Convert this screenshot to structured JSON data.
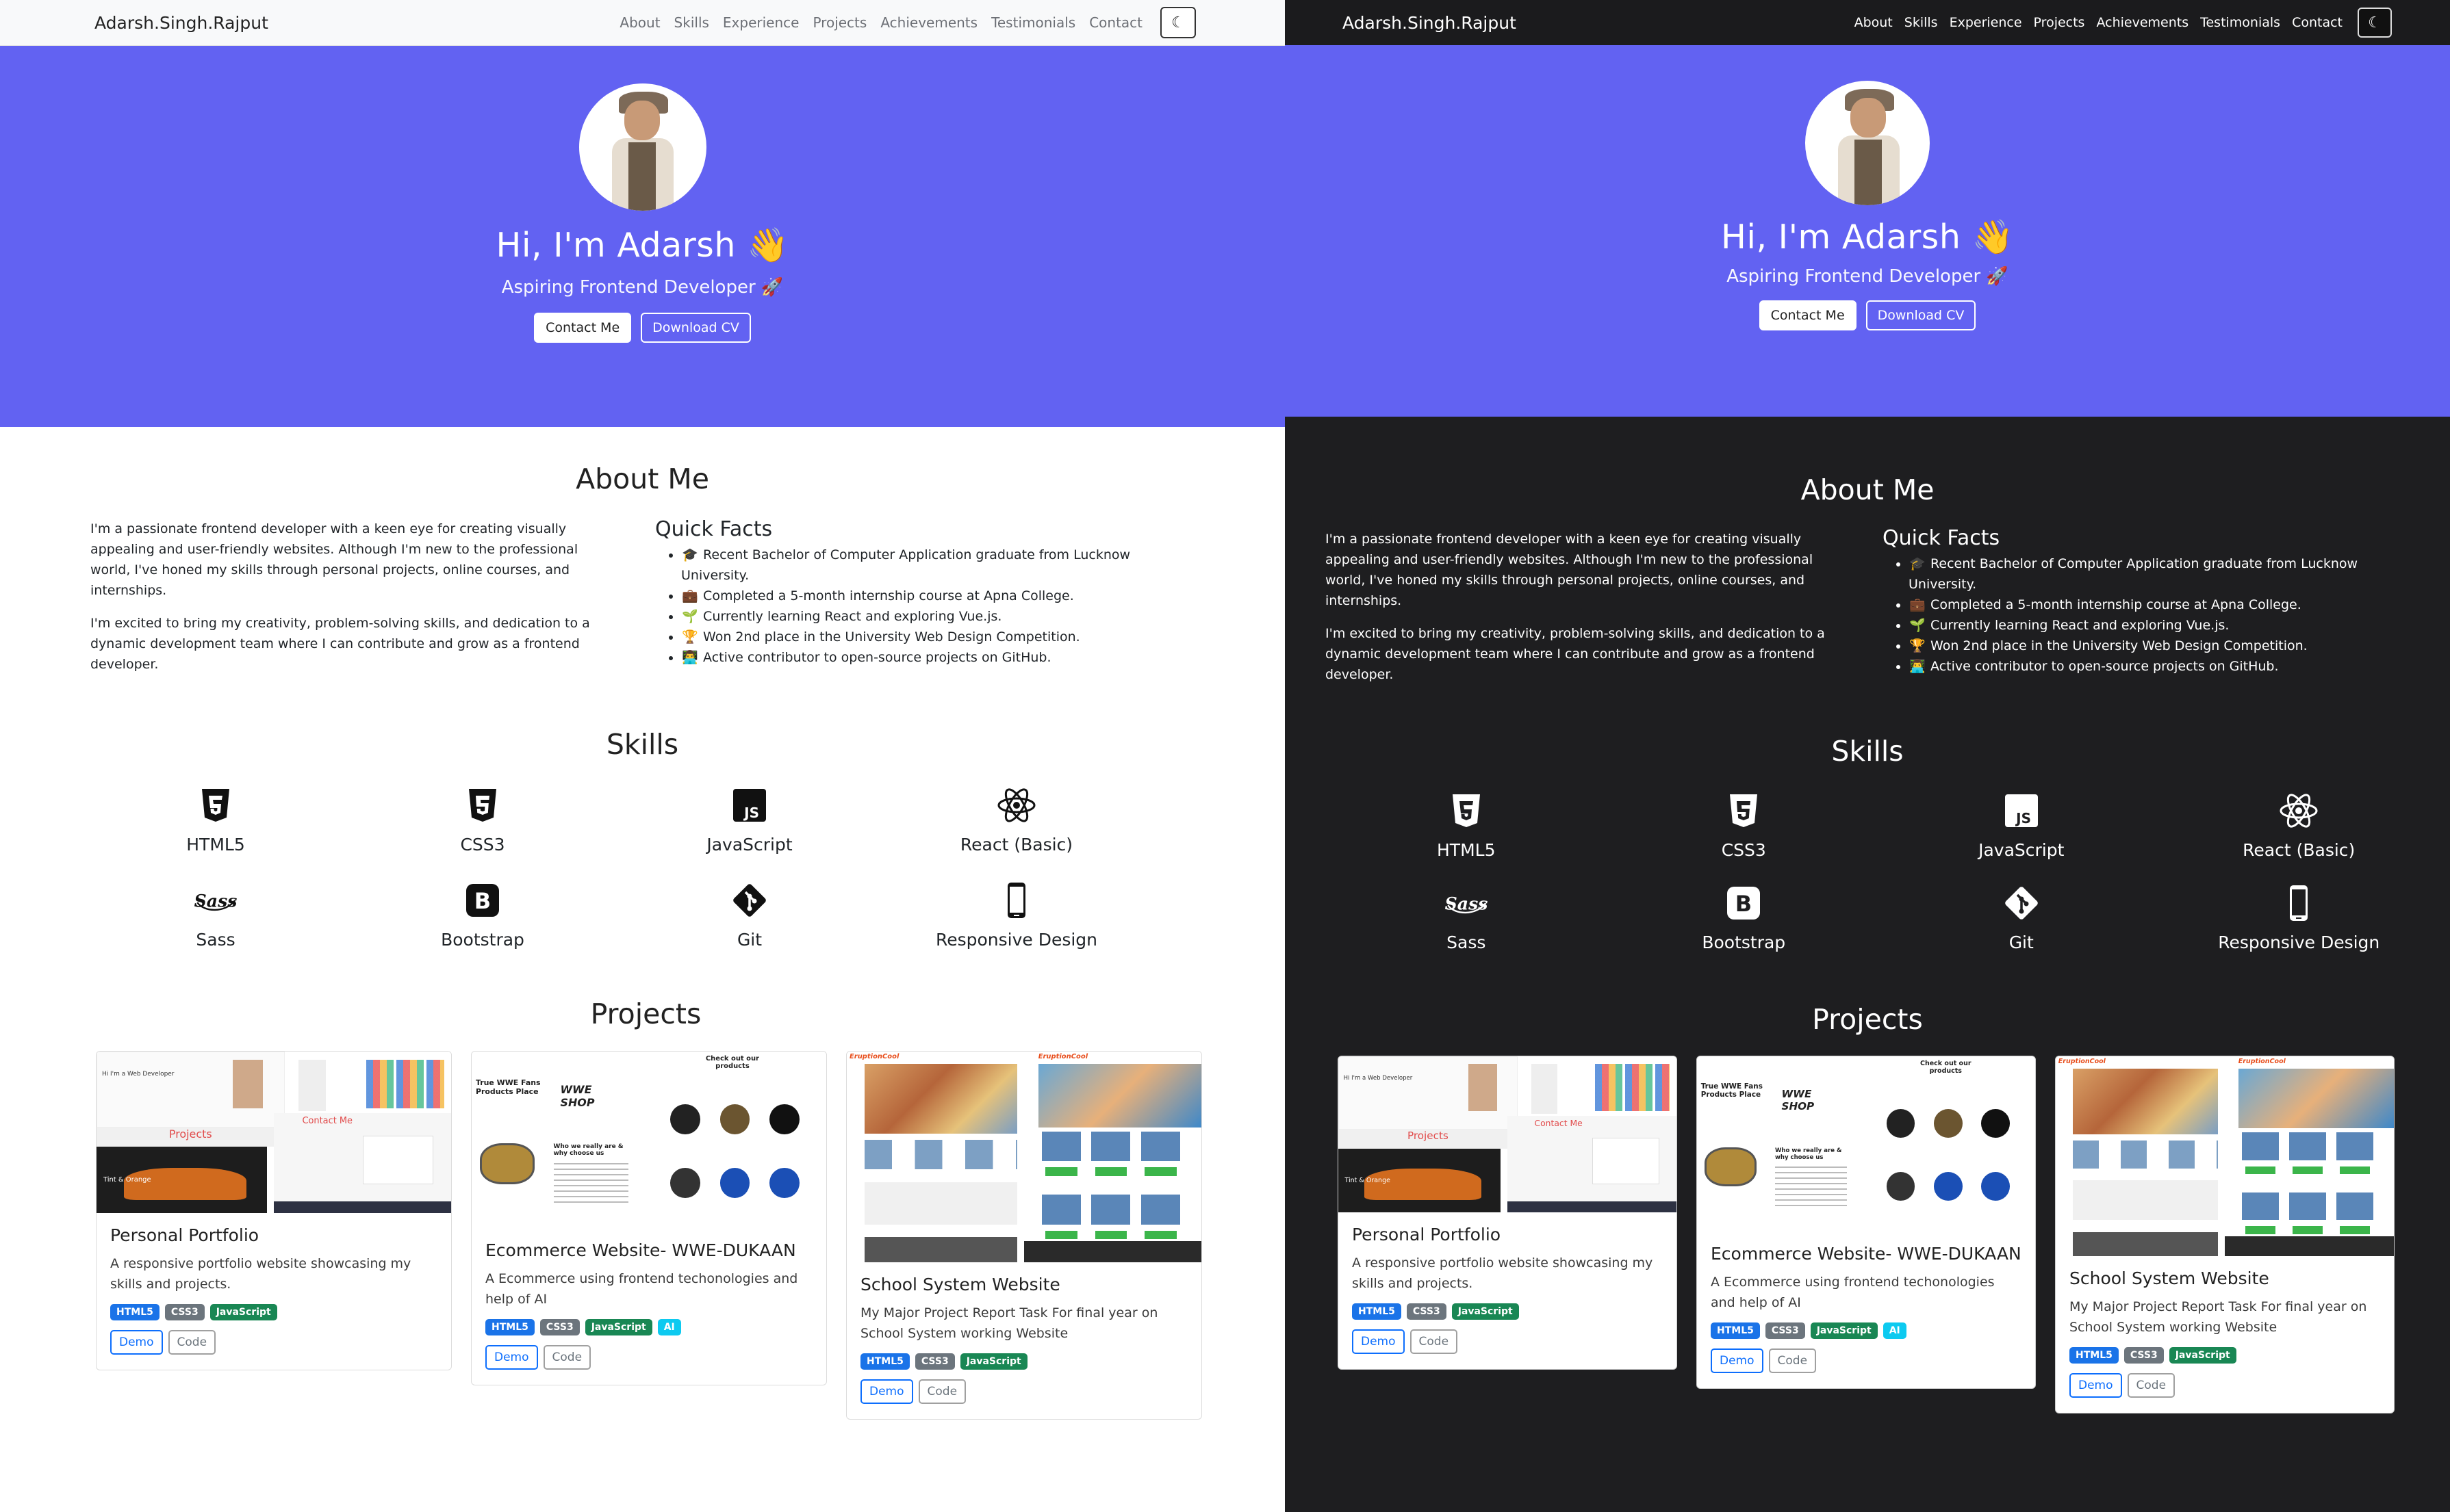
{
  "brand": "Adarsh.Singh.Rajput",
  "nav": [
    "About",
    "Skills",
    "Experience",
    "Projects",
    "Achievements",
    "Testimonials",
    "Contact"
  ],
  "theme_toggle_icon": "moon-icon",
  "hero": {
    "greeting": "Hi, I'm Adarsh 👋",
    "subtitle": "Aspiring Frontend Developer 🚀",
    "contact_button": "Contact Me",
    "cv_button": "Download CV",
    "bg_color": "#6262f2"
  },
  "about": {
    "title": "About Me",
    "paragraphs": [
      "I'm a passionate frontend developer with a keen eye for creating visually appealing and user-friendly websites. Although I'm new to the professional world, I've honed my skills through personal projects, online courses, and internships.",
      "I'm excited to bring my creativity, problem-solving skills, and dedication to a dynamic development team where I can contribute and grow as a frontend developer."
    ],
    "facts_title": "Quick Facts",
    "facts": [
      {
        "icon": "🎓",
        "text": "Recent Bachelor of Computer Application graduate from Lucknow University."
      },
      {
        "icon": "💼",
        "text": "Completed a 5-month internship course at Apna College."
      },
      {
        "icon": "🌱",
        "text": "Currently learning React and exploring Vue.js."
      },
      {
        "icon": "🏆",
        "text": "Won 2nd place in the University Web Design Competition."
      },
      {
        "icon": "👨‍💻",
        "text": "Active contributor to open-source projects on GitHub."
      }
    ]
  },
  "skills": {
    "title": "Skills",
    "items": [
      {
        "label": "HTML5",
        "icon": "html5-icon"
      },
      {
        "label": "CSS3",
        "icon": "css3-icon"
      },
      {
        "label": "JavaScript",
        "icon": "javascript-icon"
      },
      {
        "label": "React (Basic)",
        "icon": "react-icon"
      },
      {
        "label": "Sass",
        "icon": "sass-icon"
      },
      {
        "label": "Bootstrap",
        "icon": "bootstrap-icon"
      },
      {
        "label": "Git",
        "icon": "git-icon"
      },
      {
        "label": "Responsive Design",
        "icon": "phone-icon"
      }
    ]
  },
  "projects": {
    "title": "Projects",
    "items": [
      {
        "title": "Personal Portfolio",
        "description": "A responsive portfolio website showcasing my skills and projects.",
        "badges": [
          "HTML5",
          "CSS3",
          "JavaScript"
        ],
        "demo": "Demo",
        "code": "Code"
      },
      {
        "title": "Ecommerce Website- WWE-DUKAAN",
        "description": "A Ecommerce using frontend techonologies and help of AI",
        "badges": [
          "HTML5",
          "CSS3",
          "JavaScript",
          "AI"
        ],
        "demo": "Demo",
        "code": "Code"
      },
      {
        "title": "School System Website",
        "description": "My Major Project Report Task For final year on School System working Website",
        "badges": [
          "HTML5",
          "CSS3",
          "JavaScript"
        ],
        "demo": "Demo",
        "code": "Code"
      }
    ]
  },
  "thumbnails": {
    "portfolio": {
      "small_header": "Hi I'm a Web Developer",
      "section": "Projects",
      "contact": "Contact Me",
      "car_title": "Tint & Orange"
    },
    "ecommerce": {
      "headline": "True WWE Fans Products Place",
      "logo": "WWE SHOP",
      "check_out": "Check out our products",
      "who": "Who we really are & why choose us"
    },
    "school": {
      "logo": "EruptionCool"
    }
  }
}
